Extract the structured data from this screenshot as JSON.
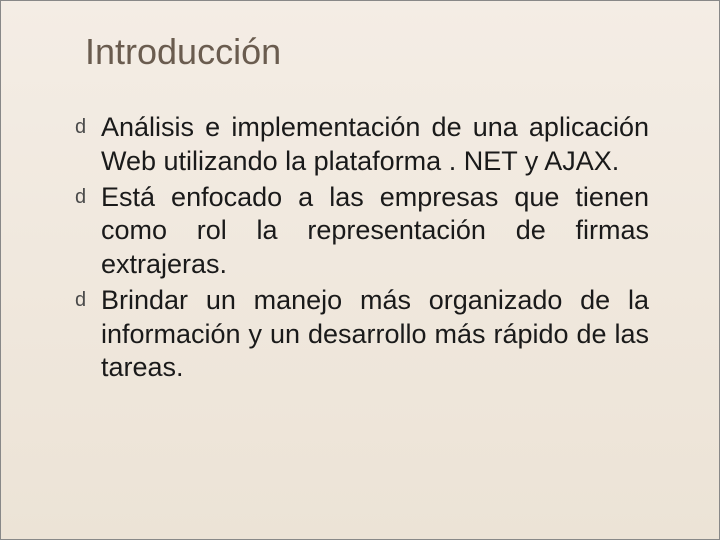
{
  "slide": {
    "title": "Introducción",
    "bullets": [
      {
        "text": "Análisis e implementación de una aplicación Web utilizando la plataforma . NET y AJAX."
      },
      {
        "text": "Está enfocado a las empresas que tienen como rol la representación de firmas extrajeras."
      },
      {
        "text": "Brindar un manejo más organizado de la información y un desarrollo más rápido de las tareas."
      }
    ],
    "bullet_glyph": "d"
  }
}
